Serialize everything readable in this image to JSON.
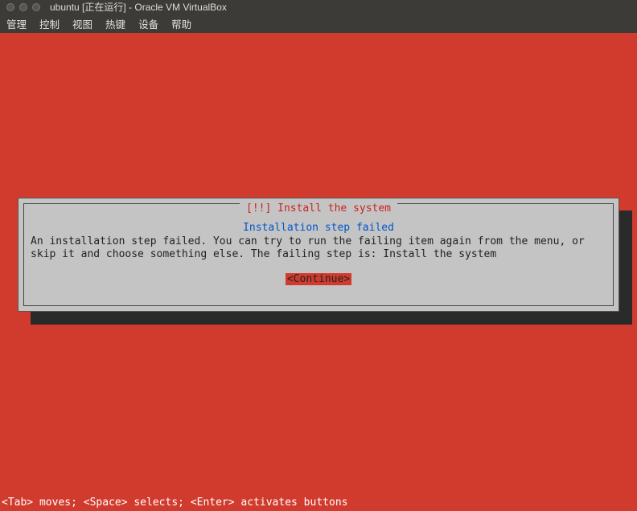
{
  "window": {
    "title": "ubuntu [正在运行] - Oracle VM VirtualBox"
  },
  "menu": {
    "items": [
      "管理",
      "控制",
      "视图",
      "热键",
      "设备",
      "帮助"
    ]
  },
  "dialog": {
    "title": "[!!] Install the system",
    "subtitle": "Installation step failed",
    "message": "An installation step failed. You can try to run the failing item again from the menu, or skip it and choose something else. The failing step is: Install the system",
    "button": "<Continue>"
  },
  "footer": {
    "help": "<Tab> moves; <Space> selects; <Enter> activates buttons"
  }
}
